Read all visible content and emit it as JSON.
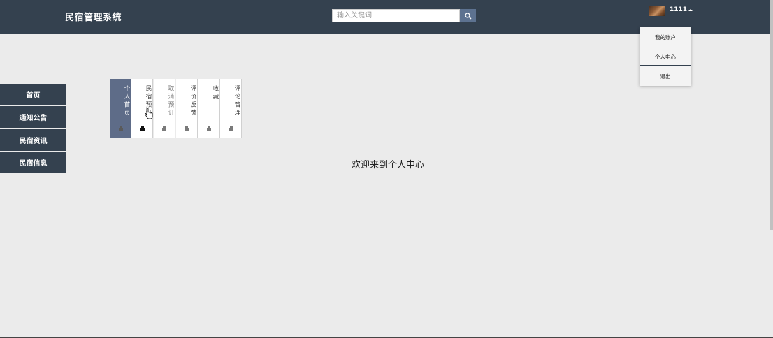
{
  "header": {
    "brand": "民宿管理系统",
    "search": {
      "placeholder": "输入关键词",
      "value": ""
    },
    "user": {
      "name": "1111"
    }
  },
  "user_menu": {
    "items": [
      "我的账户",
      "个人中心",
      "退出"
    ]
  },
  "sidebar": {
    "items": [
      "首页",
      "通知公告",
      "民宿资讯",
      "民宿信息"
    ]
  },
  "tabs": {
    "items": [
      "个人首页",
      "民宿预订",
      "取消预订",
      "评价反馈",
      "收藏",
      "评论管理"
    ],
    "active_index": 0
  },
  "main": {
    "welcome": "欢迎来到个人中心"
  },
  "colors": {
    "header_bg": "#34414f",
    "sidebar_bg": "#34414f",
    "active_tab_bg": "#5e6c88",
    "search_button_bg": "#5d7290",
    "page_bg": "#ebebeb"
  }
}
